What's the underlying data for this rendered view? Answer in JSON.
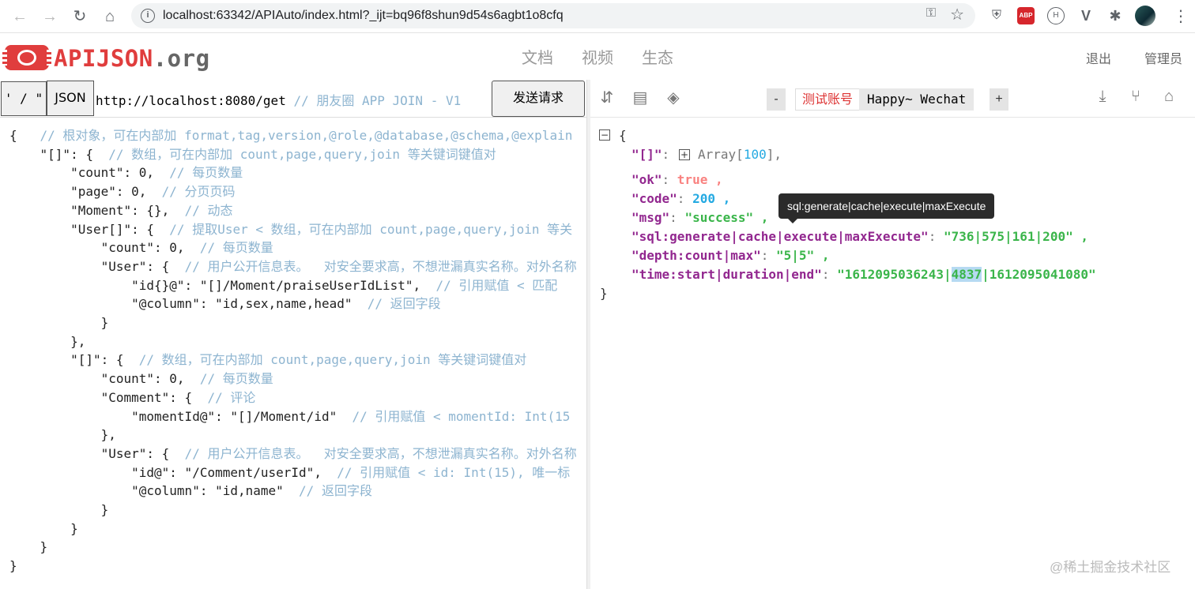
{
  "browser": {
    "url": "localhost:63342/APIAuto/index.html?_ijt=bq96f8shun9d54s6agbt1o8cfq",
    "back_icon": "←",
    "forward_icon": "→",
    "reload_icon": "↻",
    "home_icon": "⌂",
    "info_icon": "i",
    "key_icon": "⚿",
    "star_icon": "☆",
    "extensions": [
      "⛨",
      "ABP",
      "H",
      "V",
      "✱"
    ],
    "menu_icon": "⋮"
  },
  "app": {
    "logo_main": "APIJSON",
    "logo_suffix": ".org",
    "nav": [
      "文档",
      "视频",
      "生态"
    ],
    "logout": "退出",
    "admin": "管理员"
  },
  "left": {
    "quote_button": "' / \"",
    "json_button": "JSON",
    "url": "http://localhost:8080/get",
    "url_comment": "  // 朋友圈 APP JOIN - V1",
    "send_button": "发送请求",
    "code": [
      {
        "code": "{   ",
        "comment": "// 根对象，可在内部加 format,tag,version,@role,@database,@schema,@explain"
      },
      {
        "code": "    \"[]\": {  ",
        "comment": "// 数组，可在内部加 count,page,query,join 等关键词键值对"
      },
      {
        "code": "        \"count\": 0,  ",
        "comment": "// 每页数量"
      },
      {
        "code": "        \"page\": 0,  ",
        "comment": "// 分页页码"
      },
      {
        "code": "        \"Moment\": {},  ",
        "comment": "// 动态"
      },
      {
        "code": "        \"User[]\": {  ",
        "comment": "// 提取User < 数组，可在内部加 count,page,query,join 等关"
      },
      {
        "code": "            \"count\": 0,  ",
        "comment": "// 每页数量"
      },
      {
        "code": "            \"User\": {  ",
        "comment": "// 用户公开信息表。  对安全要求高，不想泄漏真实名称。对外名称"
      },
      {
        "code": "                \"id{}@\": \"[]/Moment/praiseUserIdList\",  ",
        "comment": "// 引用赋值 < 匹配"
      },
      {
        "code": "                \"@column\": \"id,sex,name,head\"  ",
        "comment": "// 返回字段"
      },
      {
        "code": "            }",
        "comment": ""
      },
      {
        "code": "        },",
        "comment": ""
      },
      {
        "code": "        \"[]\": {  ",
        "comment": "// 数组，可在内部加 count,page,query,join 等关键词键值对"
      },
      {
        "code": "            \"count\": 0,  ",
        "comment": "// 每页数量"
      },
      {
        "code": "            \"Comment\": {  ",
        "comment": "// 评论"
      },
      {
        "code": "                \"momentId@\": \"[]/Moment/id\"  ",
        "comment": "// 引用赋值 < momentId: Int(15"
      },
      {
        "code": "            },",
        "comment": ""
      },
      {
        "code": "            \"User\": {  ",
        "comment": "// 用户公开信息表。  对安全要求高，不想泄漏真实名称。对外名称"
      },
      {
        "code": "                \"id@\": \"/Comment/userId\",  ",
        "comment": "// 引用赋值 < id: Int(15), 唯一标"
      },
      {
        "code": "                \"@column\": \"id,name\"  ",
        "comment": "// 返回字段"
      },
      {
        "code": "            }",
        "comment": ""
      },
      {
        "code": "        }",
        "comment": ""
      },
      {
        "code": "    }",
        "comment": ""
      },
      {
        "code": "}",
        "comment": ""
      }
    ]
  },
  "right": {
    "toolbar_icons": {
      "format": "⇵",
      "save": "▤",
      "layers": "◈",
      "download": "⤓",
      "share": "⑂",
      "shirt": "⌂"
    },
    "account_minus": "-",
    "account_label": "测试账号",
    "account_user": "Happy~  Wechat",
    "account_plus": "+",
    "result": {
      "array_key": "\"[]\"",
      "array_value": "Array",
      "array_count": "100",
      "ok_key": "\"ok\"",
      "ok_value": "true",
      "code_key": "\"code\"",
      "code_value": "200",
      "msg_key": "\"msg\"",
      "msg_value": "\"success\"",
      "sql_key": "\"sql:generate|cache|execute|maxExecute\"",
      "sql_value": "\"736|575|161|200\"",
      "depth_key": "\"depth:count|max\"",
      "depth_value": "\"5|5\"",
      "time_key": "\"time:start|duration|end\"",
      "time_value_start": "\"1612095036243|",
      "time_value_duration": "4837",
      "time_value_end": "|1612095041080\""
    },
    "tooltip": "sql:generate|cache|execute|maxExecute"
  },
  "watermark": "@稀土掘金技术社区"
}
